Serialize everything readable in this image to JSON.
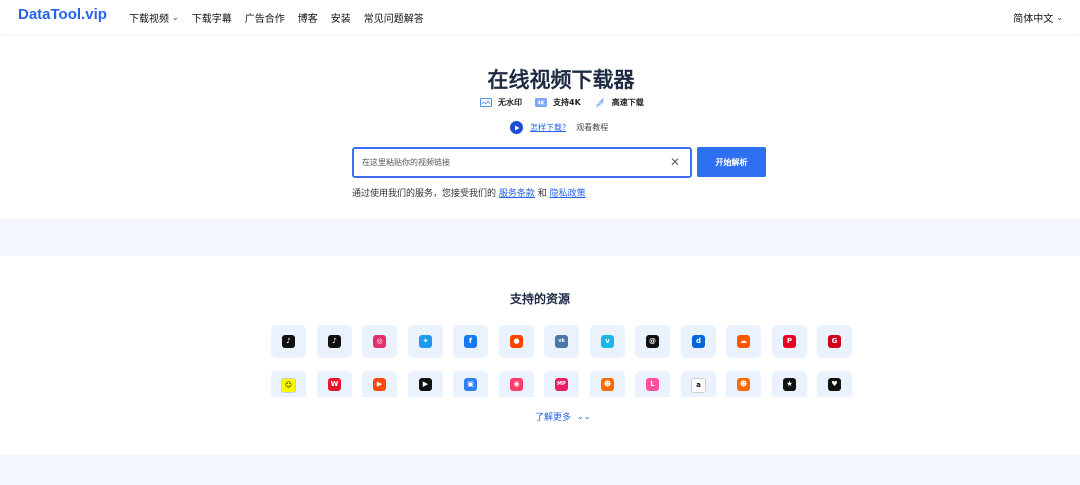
{
  "header": {
    "logo": "DataTool.vip",
    "nav": [
      {
        "label": "下载视频",
        "dropdown": true
      },
      {
        "label": "下载字幕",
        "dropdown": false
      },
      {
        "label": "广告合作",
        "dropdown": false
      },
      {
        "label": "博客",
        "dropdown": false
      },
      {
        "label": "安装",
        "dropdown": false
      },
      {
        "label": "常见问题解答",
        "dropdown": false
      }
    ],
    "language": "简体中文"
  },
  "hero": {
    "title": "在线视频下载器",
    "features": [
      {
        "label": "无水印",
        "icon": "no-watermark-icon"
      },
      {
        "label": "支持4K",
        "icon": "4k-icon"
      },
      {
        "label": "高速下载",
        "icon": "rocket-icon"
      }
    ],
    "howto_link": "怎样下载?",
    "howto_text": "观看教程",
    "search_placeholder": "在这里粘贴你的视频链接",
    "parse_button": "开始解析",
    "terms_prefix": "通过使用我们的服务，您接受我们的",
    "terms_link": "服务条款",
    "terms_and": "和",
    "privacy_link": "隐私政策"
  },
  "resources": {
    "title": "支持的资源",
    "more_label": "了解更多",
    "row1": [
      {
        "icon": "tiktok-icon",
        "color": "#111111",
        "glyph": "♪"
      },
      {
        "icon": "douyin-icon",
        "color": "#111111",
        "glyph": "♪"
      },
      {
        "icon": "instagram-icon",
        "color": "#e1306c",
        "glyph": "◎"
      },
      {
        "icon": "twitter-icon",
        "color": "#1d9bf0",
        "glyph": "✦"
      },
      {
        "icon": "facebook-icon",
        "color": "#1877f2",
        "glyph": "f"
      },
      {
        "icon": "reddit-icon",
        "color": "#ff4500",
        "glyph": "●"
      },
      {
        "icon": "vk-icon",
        "color": "#4a76a8",
        "glyph": "vk"
      },
      {
        "icon": "vimeo-icon",
        "color": "#1ab7ea",
        "glyph": "v"
      },
      {
        "icon": "threads-icon",
        "color": "#111111",
        "glyph": "@"
      },
      {
        "icon": "dailymotion-icon",
        "color": "#0066dc",
        "glyph": "d"
      },
      {
        "icon": "soundcloud-icon",
        "color": "#ff5500",
        "glyph": "☁"
      },
      {
        "icon": "pinterest-icon",
        "color": "#e60023",
        "glyph": "P"
      },
      {
        "icon": "9gag-icon",
        "color": "#d0021b",
        "glyph": "G"
      }
    ],
    "row2": [
      {
        "icon": "snapchat-icon",
        "color": "#fffc00",
        "glyph": "☺"
      },
      {
        "icon": "weibo-icon",
        "color": "#e6162d",
        "glyph": "W"
      },
      {
        "icon": "kuaishou-icon",
        "color": "#ff4906",
        "glyph": "▶"
      },
      {
        "icon": "video-player-icon",
        "color": "#111111",
        "glyph": "▶"
      },
      {
        "icon": "live-icon",
        "color": "#2f80ed",
        "glyph": "▣"
      },
      {
        "icon": "camera-app-icon",
        "color": "#ff3b6b",
        "glyph": "◉"
      },
      {
        "icon": "mp-icon",
        "color": "#e91e63",
        "glyph": "MP"
      },
      {
        "icon": "xigua-icon",
        "color": "#ff6a00",
        "glyph": "☻"
      },
      {
        "icon": "likee-icon",
        "color": "#ff4fa0",
        "glyph": "L"
      },
      {
        "icon": "amazon-icon",
        "color": "#ffffff",
        "glyph": "a"
      },
      {
        "icon": "pipix-icon",
        "color": "#ff6a00",
        "glyph": "☻"
      },
      {
        "icon": "bilibili-icon",
        "color": "#111111",
        "glyph": "★"
      },
      {
        "icon": "heart-app-icon",
        "color": "#111111",
        "glyph": "♥"
      }
    ]
  }
}
